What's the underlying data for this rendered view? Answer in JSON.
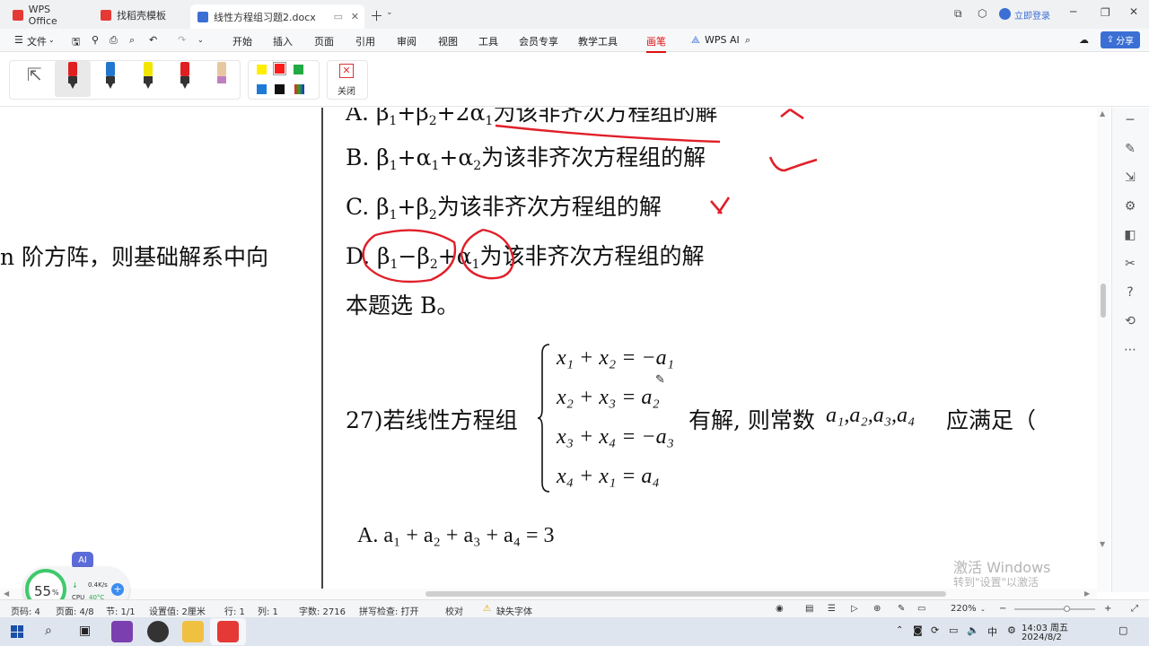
{
  "titlebar": {
    "tabs": [
      {
        "label": "WPS Office",
        "icon": "wps-logo-icon",
        "color": "#e53935"
      },
      {
        "label": "找稻壳模板",
        "icon": "docer-icon",
        "color": "#e53935"
      },
      {
        "label": "线性方程组习题2.docx",
        "icon": "word-doc-icon",
        "color": "#3b6fd4"
      }
    ],
    "login_label": "立即登录"
  },
  "menubar": {
    "file_label": "文件",
    "items": [
      "开始",
      "插入",
      "页面",
      "引用",
      "审阅",
      "视图",
      "工具",
      "会员专享",
      "教学工具",
      "画笔",
      "WPS AI"
    ],
    "active": "画笔",
    "share_label": "分享"
  },
  "pentoolbar": {
    "close_label": "关闭",
    "pens": [
      {
        "name": "red-pen",
        "color": "#e02020"
      },
      {
        "name": "blue-pen",
        "color": "#2277cc"
      },
      {
        "name": "yellow-highlighter",
        "color": "#f2e600"
      },
      {
        "name": "red-marker",
        "color": "#e02020"
      },
      {
        "name": "eraser",
        "color": "#e8c8a0"
      }
    ],
    "swatches": [
      "#ffee00",
      "#ff1a1a",
      "#22aa44",
      "#1f7ad6",
      "#111111"
    ]
  },
  "document": {
    "left_fragment": "n 阶方阵，则基础解系中向",
    "optA_prefix": "A. β",
    "optA_rest": "+β",
    "optA_tail": "+2α",
    "optA_text": "为该非齐次方程组的解",
    "optB_prefix": "B. β",
    "optB_mid1": "+α",
    "optB_mid2": "+α",
    "optB_text": "为该非齐次方程组的解",
    "optC_prefix": "C. β",
    "optC_mid": "+β",
    "optC_text": "为该非齐次方程组的解",
    "optD_prefix": "D. β",
    "optD_mid1": "−β",
    "optD_mid2": "+α",
    "optD_text": "为该非齐次方程组的解",
    "answer": "本题选 B。",
    "q27_label": "27)若线性方程组",
    "q27_tail": "有解, 则常数",
    "q27_consts": "a₁,a₂,a₃,a₄",
    "q27_end": "应满足（",
    "eq1": "x₁ + x₂ = −a₁",
    "eq2": "x₂ + x₃ = a₂",
    "eq3": "x₃ + x₄ = −a₃",
    "eq4": "x₄ + x₁ = a₄",
    "choiceA": "A. a₁ + a₂ + a₃ + a₄ = 3",
    "watermark1": "激活 Windows",
    "watermark2": "转到\"设置\"以激活 Windows。"
  },
  "perf_widget": {
    "percent": "55",
    "percent_unit": "%",
    "net": "0.4K/s",
    "cpu": "CPU",
    "cpu_temp": "40°C",
    "ai_label": "AI"
  },
  "statusbar": {
    "page": "页码: 4",
    "pages": "页面: 4/8",
    "section": "节: 1/1",
    "setting": "设置值: 2厘米",
    "row": "行: 1",
    "col": "列: 1",
    "words": "字数: 2716",
    "spell": "拼写检查: 打开",
    "proof": "校对",
    "missing_font": "缺失字体",
    "zoom": "220%"
  },
  "taskbar": {
    "time": "14:03 周五",
    "date": "2024/8/2",
    "ime": "中"
  }
}
